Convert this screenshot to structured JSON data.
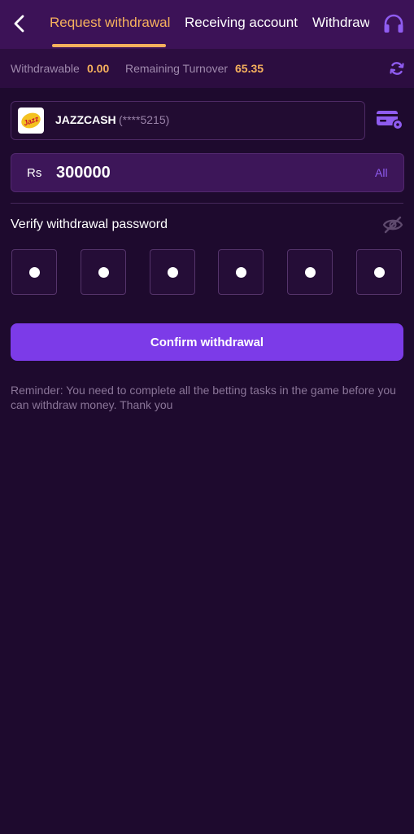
{
  "header": {
    "tabs": [
      {
        "label": "Request withdrawal",
        "active": true
      },
      {
        "label": "Receiving account",
        "active": false
      },
      {
        "label": "Withdraw",
        "active": false
      }
    ],
    "back_icon": "chevron-left-icon",
    "support_icon": "headset-icon"
  },
  "balance": {
    "withdrawable_label": "Withdrawable",
    "withdrawable_value": "0.00",
    "turnover_label": "Remaining Turnover",
    "turnover_value": "65.35",
    "refresh_icon": "refresh-icon"
  },
  "account": {
    "logo_text": "Jazz",
    "name": "JAZZCASH",
    "masked_number": "(****5215)",
    "settings_icon": "card-settings-icon"
  },
  "amount": {
    "currency": "Rs",
    "value": "300000",
    "all_label": "All"
  },
  "password": {
    "label": "Verify withdrawal password",
    "eye_icon": "eye-off-icon",
    "digits_filled": 6
  },
  "confirm_label": "Confirm withdrawal",
  "reminder": "Reminder: You need to complete all the betting tasks in the game before you can withdraw money. Thank you",
  "colors": {
    "accent": "#7c3be8",
    "highlight": "#f6b15d",
    "background": "#1e0a2e",
    "header": "#3c1257"
  }
}
